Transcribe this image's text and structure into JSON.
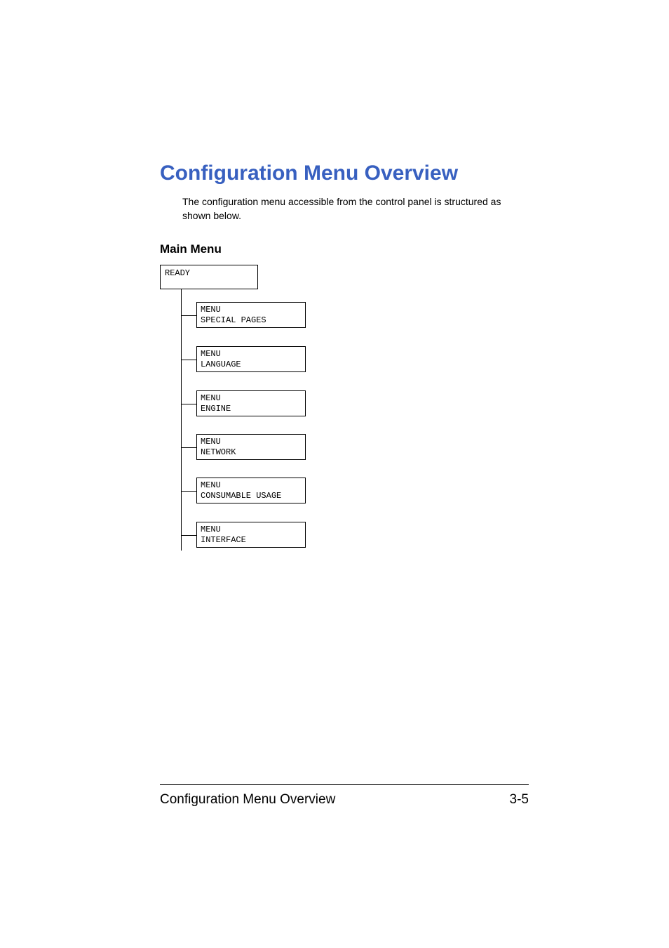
{
  "heading": "Configuration Menu Overview",
  "intro": "The configuration menu accessible from the control panel is structured as shown below.",
  "subheading": "Main Menu",
  "tree": {
    "root": "READY",
    "items": [
      {
        "line1": "MENU",
        "line2": "SPECIAL PAGES"
      },
      {
        "line1": "MENU",
        "line2": "LANGUAGE"
      },
      {
        "line1": "MENU",
        "line2": "ENGINE"
      },
      {
        "line1": "MENU",
        "line2": "NETWORK"
      },
      {
        "line1": "MENU",
        "line2": "CONSUMABLE USAGE"
      },
      {
        "line1": "MENU",
        "line2": "INTERFACE"
      }
    ]
  },
  "footer": {
    "title": "Configuration Menu Overview",
    "page": "3-5"
  }
}
